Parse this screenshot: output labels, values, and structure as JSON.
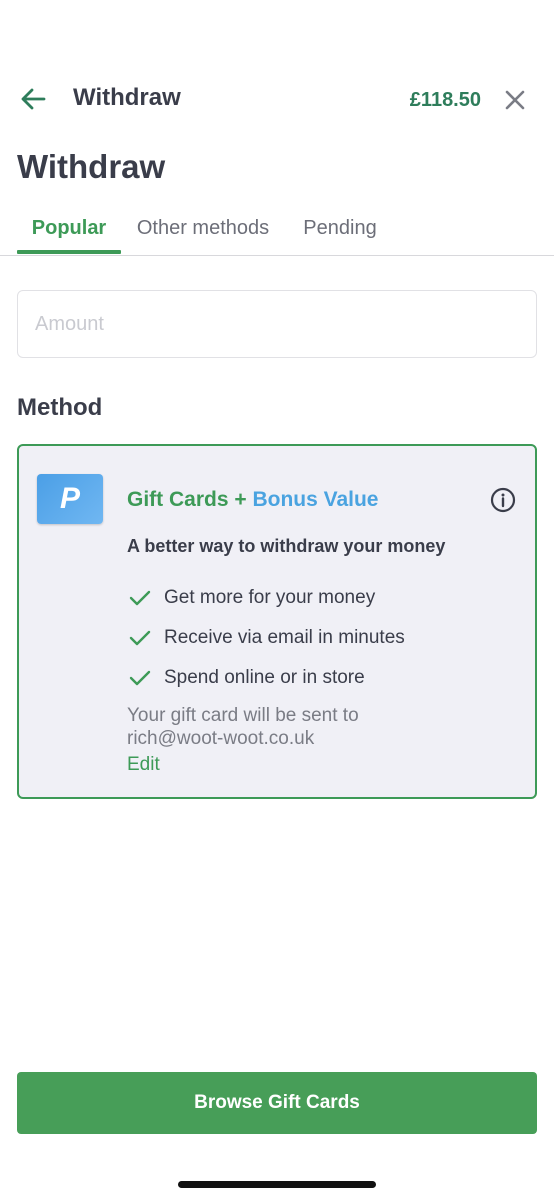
{
  "header": {
    "title": "Withdraw",
    "balance": "£118.50",
    "back_icon": "arrow-left-icon",
    "close_icon": "close-icon"
  },
  "page_title": "Withdraw",
  "tabs": [
    {
      "label": "Popular",
      "active": true
    },
    {
      "label": "Other methods",
      "active": false
    },
    {
      "label": "Pending",
      "active": false
    }
  ],
  "amount": {
    "value": "",
    "placeholder": "Amount"
  },
  "method_section_label": "Method",
  "method_card": {
    "logo_letter": "P",
    "title_part1": "Gift Cards + ",
    "title_part2": "Bonus Value",
    "subtitle": "A better way to withdraw your money",
    "features": [
      "Get more for your money",
      "Receive via email in minutes",
      "Spend online or in store"
    ],
    "delivery_note": "Your gift card will be sent to rich@woot-woot.co.uk",
    "edit_label": "Edit",
    "info_icon": "info-icon",
    "check_icon": "check-icon"
  },
  "cta": {
    "label": "Browse Gift Cards"
  },
  "colors": {
    "accent_green": "#3d9a57",
    "balance_green": "#2e7d5b",
    "bonus_blue": "#4aa3e0",
    "card_background": "#f0f0f6",
    "text_dark": "#3a3d4a"
  }
}
